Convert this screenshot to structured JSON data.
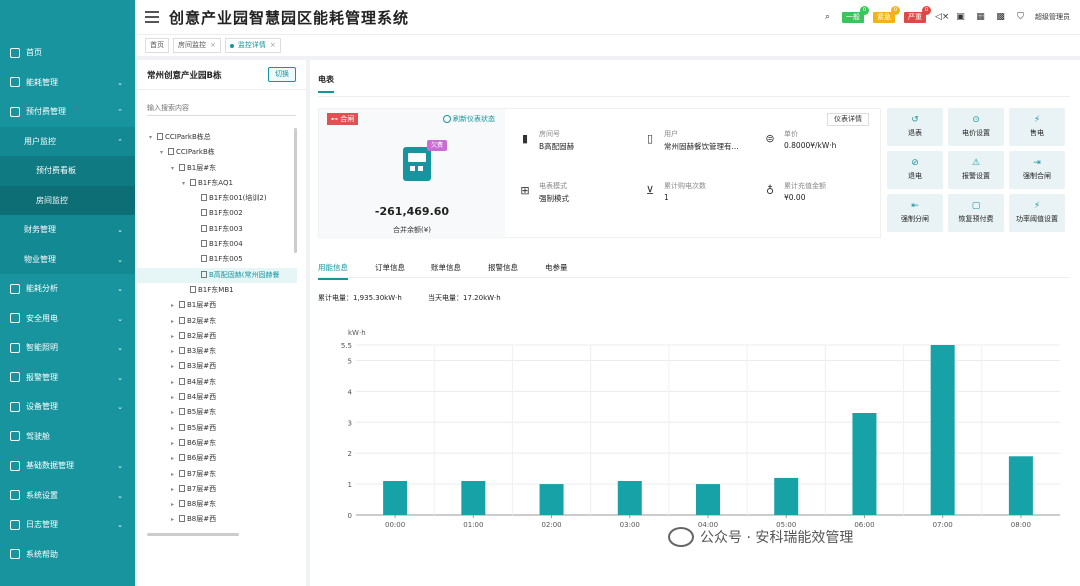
{
  "header": {
    "title": "创意产业园智慧园区能耗管理系统",
    "alarms": [
      {
        "label": "一般",
        "count": "0",
        "color": "#3cc35c"
      },
      {
        "label": "紧急",
        "count": "0",
        "color": "#f2b414"
      },
      {
        "label": "严重",
        "count": "0",
        "color": "#e04848"
      }
    ],
    "user": "超级管理员"
  },
  "sidebar": {
    "items": [
      {
        "label": "首页",
        "icon": "home-icon",
        "level": 0,
        "chev": ""
      },
      {
        "label": "能耗管理",
        "icon": "energy-icon",
        "level": 0,
        "chev": "⌄"
      },
      {
        "label": "预付费管理",
        "icon": "prepay-icon",
        "level": 0,
        "chev": "⌃"
      },
      {
        "label": "用户监控",
        "icon": "",
        "level": 1,
        "chev": "⌃"
      },
      {
        "label": "预付费看板",
        "icon": "",
        "level": 2,
        "chev": ""
      },
      {
        "label": "房间监控",
        "icon": "",
        "level": 2,
        "chev": "",
        "active": true
      },
      {
        "label": "财务管理",
        "icon": "",
        "level": 1,
        "chev": "⌄"
      },
      {
        "label": "物业管理",
        "icon": "",
        "level": 1,
        "chev": "⌄"
      },
      {
        "label": "能耗分析",
        "icon": "analysis-icon",
        "level": 0,
        "chev": "⌄"
      },
      {
        "label": "安全用电",
        "icon": "safety-icon",
        "level": 0,
        "chev": "⌄"
      },
      {
        "label": "智能照明",
        "icon": "lighting-icon",
        "level": 0,
        "chev": "⌄"
      },
      {
        "label": "报警管理",
        "icon": "alarm-icon",
        "level": 0,
        "chev": "⌄"
      },
      {
        "label": "设备管理",
        "icon": "device-icon",
        "level": 0,
        "chev": "⌄"
      },
      {
        "label": "驾驶舱",
        "icon": "cockpit-icon",
        "level": 0,
        "chev": ""
      },
      {
        "label": "基础数据管理",
        "icon": "data-icon",
        "level": 0,
        "chev": "⌄"
      },
      {
        "label": "系统设置",
        "icon": "settings-icon",
        "level": 0,
        "chev": "⌄"
      },
      {
        "label": "日志管理",
        "icon": "log-icon",
        "level": 0,
        "chev": "⌄"
      },
      {
        "label": "系统帮助",
        "icon": "help-icon",
        "level": 0,
        "chev": ""
      }
    ]
  },
  "tabs": [
    {
      "label": "首页",
      "closable": false,
      "active": false
    },
    {
      "label": "房间监控",
      "closable": true,
      "active": false
    },
    {
      "label": "监控详情",
      "closable": true,
      "active": true
    }
  ],
  "tree_panel": {
    "title": "常州创意产业园B栋",
    "switch_label": "切换",
    "search_placeholder": "输入搜索内容",
    "nodes": [
      {
        "label": "CCIParkB栋总",
        "depth": 0,
        "arrow": "▾"
      },
      {
        "label": "CCIParkB栋",
        "depth": 1,
        "arrow": "▾"
      },
      {
        "label": "B1层#东",
        "depth": 2,
        "arrow": "▾"
      },
      {
        "label": "B1F东AQ1",
        "depth": 3,
        "arrow": "▾"
      },
      {
        "label": "B1F东001(培训2)",
        "depth": 4,
        "arrow": ""
      },
      {
        "label": "B1F东002",
        "depth": 4,
        "arrow": ""
      },
      {
        "label": "B1F东003",
        "depth": 4,
        "arrow": ""
      },
      {
        "label": "B1F东004",
        "depth": 4,
        "arrow": ""
      },
      {
        "label": "B1F东005",
        "depth": 4,
        "arrow": ""
      },
      {
        "label": "B高配固赫(常州固赫餐",
        "depth": 4,
        "arrow": "",
        "selected": true
      },
      {
        "label": "B1F东MB1",
        "depth": 3,
        "arrow": ""
      },
      {
        "label": "B1层#西",
        "depth": 2,
        "arrow": "▸"
      },
      {
        "label": "B2层#东",
        "depth": 2,
        "arrow": "▸"
      },
      {
        "label": "B2层#西",
        "depth": 2,
        "arrow": "▸"
      },
      {
        "label": "B3层#东",
        "depth": 2,
        "arrow": "▸"
      },
      {
        "label": "B3层#西",
        "depth": 2,
        "arrow": "▸"
      },
      {
        "label": "B4层#东",
        "depth": 2,
        "arrow": "▸"
      },
      {
        "label": "B4层#西",
        "depth": 2,
        "arrow": "▸"
      },
      {
        "label": "B5层#东",
        "depth": 2,
        "arrow": "▸"
      },
      {
        "label": "B5层#西",
        "depth": 2,
        "arrow": "▸"
      },
      {
        "label": "B6层#东",
        "depth": 2,
        "arrow": "▸"
      },
      {
        "label": "B6层#西",
        "depth": 2,
        "arrow": "▸"
      },
      {
        "label": "B7层#东",
        "depth": 2,
        "arrow": "▸"
      },
      {
        "label": "B7层#西",
        "depth": 2,
        "arrow": "▸"
      },
      {
        "label": "B8层#东",
        "depth": 2,
        "arrow": "▸"
      },
      {
        "label": "B8层#西",
        "depth": 2,
        "arrow": "▸"
      }
    ]
  },
  "main": {
    "tab": "电表",
    "meter": {
      "switch_tag": "⊷ 合闸",
      "refresh": "刷新仪表状态",
      "arrears": "欠费",
      "balance": "-261,469.60",
      "balance_label": "合并余额(¥)",
      "detail_button": "仪表详情",
      "info": [
        {
          "label": "房间号",
          "value": "B高配固赫",
          "icon": "door-icon"
        },
        {
          "label": "用户",
          "value": "常州固赫餐饮管理有...",
          "icon": "user-icon"
        },
        {
          "label": "单价",
          "value": "0.8000¥/kW·h",
          "icon": "price-icon"
        },
        {
          "label": "电表模式",
          "value": "强制模式",
          "icon": "mode-icon"
        },
        {
          "label": "累计购电次数",
          "value": "1",
          "icon": "cart-icon"
        },
        {
          "label": "累计充值金额",
          "value": "¥0.00",
          "icon": "money-icon"
        }
      ]
    },
    "operations": [
      {
        "label": "退表",
        "icon": "return-icon"
      },
      {
        "label": "电价设置",
        "icon": "price-setting-icon"
      },
      {
        "label": "售电",
        "icon": "sell-icon"
      },
      {
        "label": "退电",
        "icon": "refund-icon"
      },
      {
        "label": "报警设置",
        "icon": "alarm-setting-icon"
      },
      {
        "label": "强制合闸",
        "icon": "force-close-icon"
      },
      {
        "label": "强制分闸",
        "icon": "force-open-icon"
      },
      {
        "label": "恢复预付费",
        "icon": "restore-icon"
      },
      {
        "label": "功率阈值设置",
        "icon": "power-threshold-icon"
      }
    ],
    "sub_tabs": [
      "用能信息",
      "订单信息",
      "账单信息",
      "报警信息",
      "电参量"
    ],
    "stats": {
      "total": "累计电量：1,935.30kW·h",
      "today": "当天电量：17.20kW·h"
    }
  },
  "chart_data": {
    "type": "bar",
    "ylabel": "kW·h",
    "categories": [
      "00:00",
      "01:00",
      "02:00",
      "03:00",
      "04:00",
      "05:00",
      "06:00",
      "07:00",
      "08:00"
    ],
    "values": [
      1.1,
      1.1,
      1.0,
      1.1,
      1.0,
      1.2,
      3.3,
      5.5,
      1.9
    ],
    "yticks": [
      0,
      1,
      2,
      3,
      4,
      5,
      5.5
    ],
    "ylim": [
      0,
      5.5
    ],
    "grid": true,
    "color": "#17a2a8"
  },
  "watermark": "公众号 · 安科瑞能效管理",
  "colors": {
    "accent": "#17949e"
  }
}
